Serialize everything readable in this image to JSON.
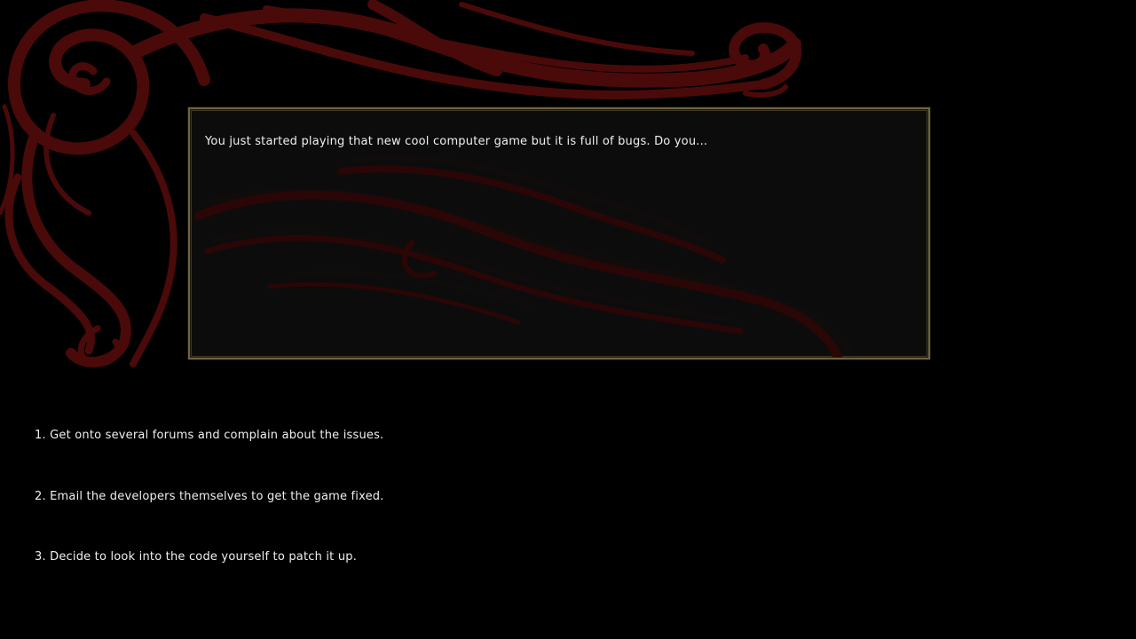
{
  "dialog": {
    "prompt": "You just started playing that new cool computer game but it is full of bugs. Do you..."
  },
  "choices": [
    {
      "label": "1. Get onto several forums and complain about the issues."
    },
    {
      "label": "2. Email the developers themselves to get the game fixed."
    },
    {
      "label": "3. Decide to look into the code yourself to patch it up."
    }
  ],
  "colors": {
    "background": "#000000",
    "ornament": "#4a0a0a",
    "panel_border": "#6e6440",
    "text": "#efefef"
  },
  "icons": {
    "background_art": "dark-red-flourish-ornament"
  }
}
